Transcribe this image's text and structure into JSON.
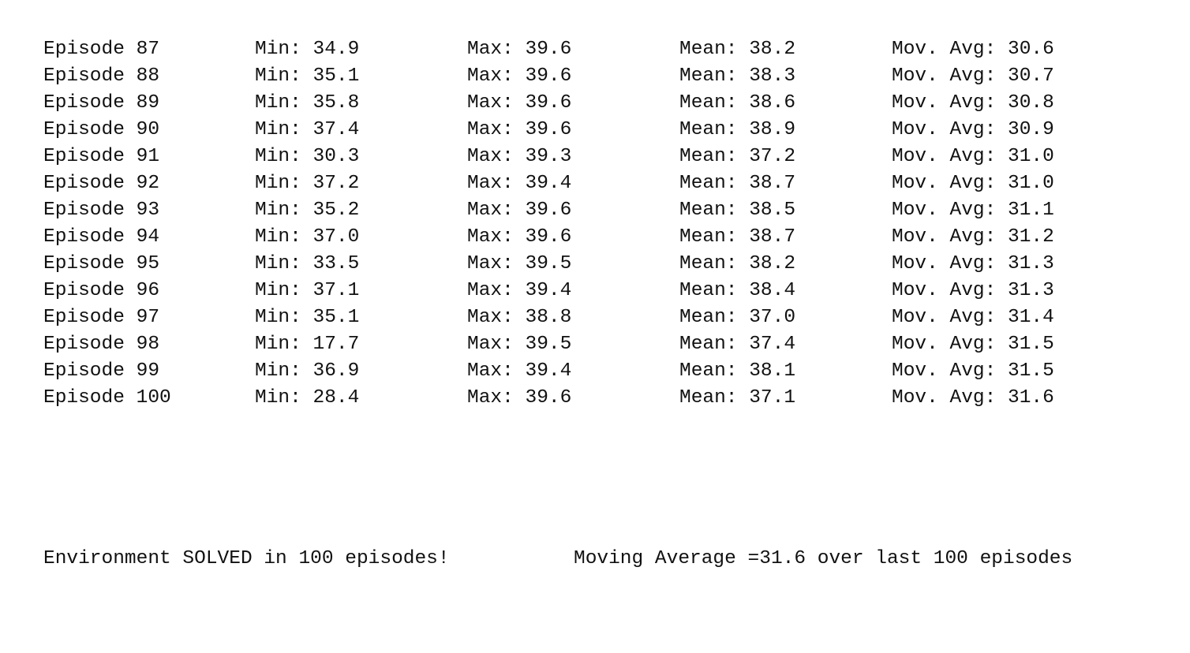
{
  "rows": [
    {
      "episode": "Episode 87",
      "min": "Min: 34.9",
      "max": "Max: 39.6",
      "mean": "Mean: 38.2",
      "mov_avg": "Mov. Avg: 30.6"
    },
    {
      "episode": "Episode 88",
      "min": "Min: 35.1",
      "max": "Max: 39.6",
      "mean": "Mean: 38.3",
      "mov_avg": "Mov. Avg: 30.7"
    },
    {
      "episode": "Episode 89",
      "min": "Min: 35.8",
      "max": "Max: 39.6",
      "mean": "Mean: 38.6",
      "mov_avg": "Mov. Avg: 30.8"
    },
    {
      "episode": "Episode 90",
      "min": "Min: 37.4",
      "max": "Max: 39.6",
      "mean": "Mean: 38.9",
      "mov_avg": "Mov. Avg: 30.9"
    },
    {
      "episode": "Episode 91",
      "min": "Min: 30.3",
      "max": "Max: 39.3",
      "mean": "Mean: 37.2",
      "mov_avg": "Mov. Avg: 31.0"
    },
    {
      "episode": "Episode 92",
      "min": "Min: 37.2",
      "max": "Max: 39.4",
      "mean": "Mean: 38.7",
      "mov_avg": "Mov. Avg: 31.0"
    },
    {
      "episode": "Episode 93",
      "min": "Min: 35.2",
      "max": "Max: 39.6",
      "mean": "Mean: 38.5",
      "mov_avg": "Mov. Avg: 31.1"
    },
    {
      "episode": "Episode 94",
      "min": "Min: 37.0",
      "max": "Max: 39.6",
      "mean": "Mean: 38.7",
      "mov_avg": "Mov. Avg: 31.2"
    },
    {
      "episode": "Episode 95",
      "min": "Min: 33.5",
      "max": "Max: 39.5",
      "mean": "Mean: 38.2",
      "mov_avg": "Mov. Avg: 31.3"
    },
    {
      "episode": "Episode 96",
      "min": "Min: 37.1",
      "max": "Max: 39.4",
      "mean": "Mean: 38.4",
      "mov_avg": "Mov. Avg: 31.3"
    },
    {
      "episode": "Episode 97",
      "min": "Min: 35.1",
      "max": "Max: 38.8",
      "mean": "Mean: 37.0",
      "mov_avg": "Mov. Avg: 31.4"
    },
    {
      "episode": "Episode 98",
      "min": "Min: 17.7",
      "max": "Max: 39.5",
      "mean": "Mean: 37.4",
      "mov_avg": "Mov. Avg: 31.5"
    },
    {
      "episode": "Episode 99",
      "min": "Min: 36.9",
      "max": "Max: 39.4",
      "mean": "Mean: 38.1",
      "mov_avg": "Mov. Avg: 31.5"
    },
    {
      "episode": "Episode 100",
      "min": "Min: 28.4",
      "max": "Max: 39.6",
      "mean": "Mean: 37.1",
      "mov_avg": "Mov. Avg: 31.6"
    }
  ],
  "summary": {
    "solved": "Environment SOLVED in 100 episodes!",
    "moving_average": "Moving Average =31.6 over last 100 episodes"
  }
}
